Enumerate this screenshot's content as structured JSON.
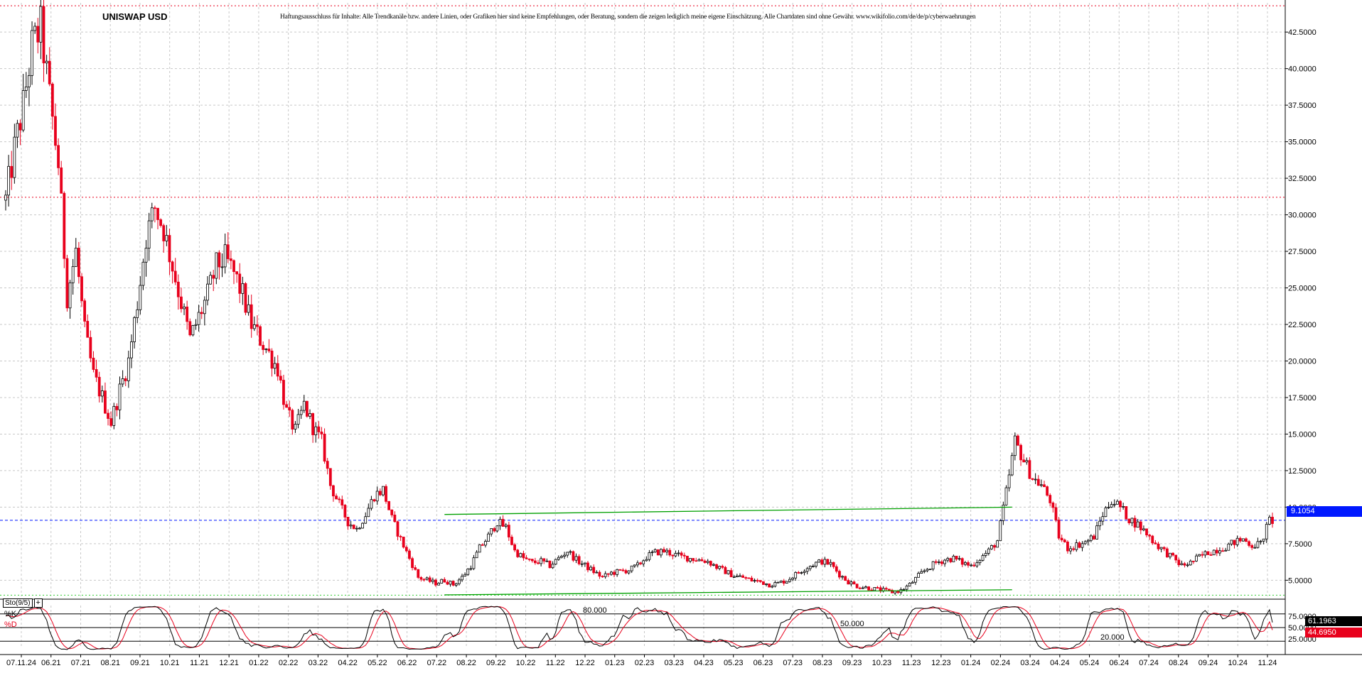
{
  "title": "UNISWAP USD",
  "disclaimer": "Haftungsausschluss für Inhalte: Alle Trendkanäle bzw. andere Linien, oder Grafiken hier sind keine Empfehlungen, oder Beratung, sondern die zeigen lediglich meine eigene Einschätzung. Alle Chartdaten sind ohne Gewähr.  www.wikifolio.com/de/de/p/cyberwaehrungen",
  "colors": {
    "up_candle": "#000000",
    "down_candle": "#e8001c",
    "trend_line": "#00a000",
    "current_price_line": "#0018ff",
    "stoch_k": "#000000",
    "stoch_d": "#e8001c",
    "grid": "#c8c8c8"
  },
  "indicator": {
    "name": "Sto(9/5)",
    "plus_icon": "+",
    "k_label": "%K",
    "d_label": "%D",
    "k_value": "61.1963",
    "d_value": "44.6950",
    "level_80": "80.000",
    "level_50": "50.000",
    "level_20": "20.000",
    "axis_ticks": [
      "75.0000",
      "50.0000",
      "25.0000"
    ]
  },
  "current_price": "9.1054",
  "chart_data": {
    "type": "candlestick",
    "title": "UNISWAP USD",
    "ylim": [
      3.9,
      44.5
    ],
    "y_ticks": [
      "5.0000",
      "7.5000",
      "10.0000",
      "12.5000",
      "15.0000",
      "17.5000",
      "20.0000",
      "22.5000",
      "25.0000",
      "27.5000",
      "30.0000",
      "32.5000",
      "35.0000",
      "37.5000",
      "40.0000",
      "42.5000"
    ],
    "x_ticks": [
      "07.11.24",
      "06.21",
      "07.21",
      "08.21",
      "09.21",
      "10.21",
      "11.21",
      "12.21",
      "01.22",
      "02.22",
      "03.22",
      "04.22",
      "05.22",
      "06.22",
      "07.22",
      "08.22",
      "09.22",
      "10.22",
      "11.22",
      "12.22",
      "01.23",
      "02.23",
      "03.23",
      "04.23",
      "05.23",
      "06.23",
      "07.23",
      "08.23",
      "09.23",
      "10.23",
      "11.23",
      "12.23",
      "01.24",
      "02.24",
      "03.24",
      "04.24",
      "05.24",
      "06.24",
      "07.24",
      "08.24",
      "09.24",
      "10.24",
      "11.24"
    ],
    "price_path": [
      [
        0,
        31.0
      ],
      [
        3,
        34.5
      ],
      [
        6,
        37.5
      ],
      [
        9,
        41.5
      ],
      [
        12,
        42.8
      ],
      [
        15,
        38.0
      ],
      [
        18,
        33.5
      ],
      [
        21,
        24.5
      ],
      [
        24,
        27.5
      ],
      [
        27,
        22.0
      ],
      [
        30,
        19.0
      ],
      [
        33,
        17.5
      ],
      [
        36,
        15.8
      ],
      [
        39,
        18.0
      ],
      [
        42,
        20.0
      ],
      [
        45,
        24.0
      ],
      [
        48,
        28.5
      ],
      [
        51,
        30.5
      ],
      [
        54,
        29.0
      ],
      [
        57,
        26.5
      ],
      [
        60,
        24.0
      ],
      [
        63,
        21.5
      ],
      [
        66,
        23.0
      ],
      [
        69,
        24.5
      ],
      [
        72,
        26.5
      ],
      [
        75,
        27.0
      ],
      [
        78,
        26.0
      ],
      [
        81,
        24.5
      ],
      [
        84,
        22.5
      ],
      [
        87,
        21.5
      ],
      [
        90,
        20.5
      ],
      [
        93,
        19.5
      ],
      [
        96,
        16.5
      ],
      [
        99,
        15.2
      ],
      [
        102,
        17.0
      ],
      [
        105,
        15.5
      ],
      [
        108,
        14.5
      ],
      [
        111,
        11.5
      ],
      [
        114,
        10.2
      ],
      [
        117,
        9.0
      ],
      [
        120,
        8.5
      ],
      [
        123,
        9.5
      ],
      [
        126,
        10.8
      ],
      [
        129,
        11.2
      ],
      [
        132,
        9.2
      ],
      [
        135,
        7.8
      ],
      [
        138,
        6.5
      ],
      [
        141,
        5.2
      ],
      [
        144,
        5.0
      ],
      [
        147,
        4.8
      ],
      [
        150,
        5.0
      ],
      [
        153,
        4.7
      ],
      [
        156,
        5.2
      ],
      [
        159,
        6.0
      ],
      [
        162,
        7.2
      ],
      [
        165,
        8.0
      ],
      [
        168,
        9.0
      ],
      [
        171,
        8.6
      ],
      [
        174,
        7.0
      ],
      [
        177,
        6.5
      ],
      [
        180,
        6.2
      ],
      [
        183,
        6.3
      ],
      [
        186,
        6.0
      ],
      [
        189,
        6.5
      ],
      [
        192,
        7.0
      ],
      [
        195,
        6.4
      ],
      [
        198,
        6.0
      ],
      [
        201,
        5.6
      ],
      [
        204,
        5.2
      ],
      [
        207,
        5.5
      ],
      [
        210,
        5.6
      ],
      [
        213,
        5.7
      ],
      [
        216,
        6.0
      ],
      [
        219,
        6.6
      ],
      [
        222,
        6.9
      ],
      [
        225,
        7.0
      ],
      [
        228,
        6.8
      ],
      [
        231,
        6.6
      ],
      [
        234,
        6.5
      ],
      [
        237,
        6.4
      ],
      [
        240,
        6.3
      ],
      [
        243,
        5.9
      ],
      [
        246,
        5.6
      ],
      [
        249,
        5.3
      ],
      [
        252,
        5.2
      ],
      [
        255,
        5.0
      ],
      [
        258,
        4.9
      ],
      [
        261,
        4.7
      ],
      [
        264,
        4.8
      ],
      [
        267,
        5.0
      ],
      [
        270,
        5.4
      ],
      [
        273,
        5.8
      ],
      [
        276,
        6.1
      ],
      [
        279,
        6.3
      ],
      [
        282,
        6.1
      ],
      [
        285,
        5.4
      ],
      [
        288,
        4.9
      ],
      [
        291,
        4.6
      ],
      [
        294,
        4.5
      ],
      [
        297,
        4.4
      ],
      [
        300,
        4.3
      ],
      [
        303,
        4.2
      ],
      [
        306,
        4.3
      ],
      [
        309,
        4.7
      ],
      [
        312,
        5.3
      ],
      [
        315,
        5.8
      ],
      [
        318,
        6.2
      ],
      [
        321,
        6.4
      ],
      [
        324,
        6.5
      ],
      [
        327,
        6.2
      ],
      [
        330,
        6.0
      ],
      [
        333,
        6.5
      ],
      [
        336,
        7.0
      ],
      [
        339,
        7.7
      ],
      [
        342,
        11.0
      ],
      [
        345,
        14.5
      ],
      [
        348,
        13.2
      ],
      [
        351,
        12.0
      ],
      [
        354,
        11.5
      ],
      [
        357,
        10.5
      ],
      [
        360,
        8.0
      ],
      [
        363,
        7.2
      ],
      [
        366,
        7.4
      ],
      [
        369,
        7.6
      ],
      [
        372,
        8.0
      ],
      [
        375,
        9.5
      ],
      [
        378,
        10.5
      ],
      [
        381,
        10.0
      ],
      [
        384,
        9.2
      ],
      [
        387,
        8.8
      ],
      [
        390,
        8.2
      ],
      [
        393,
        7.5
      ],
      [
        396,
        7.0
      ],
      [
        399,
        6.5
      ],
      [
        402,
        6.0
      ],
      [
        405,
        6.2
      ],
      [
        408,
        6.6
      ],
      [
        411,
        6.9
      ],
      [
        414,
        7.1
      ],
      [
        417,
        7.3
      ],
      [
        420,
        7.6
      ],
      [
        423,
        7.8
      ],
      [
        426,
        7.4
      ],
      [
        429,
        7.5
      ],
      [
        432,
        9.1
      ]
    ],
    "trendlines": [
      {
        "from": [
          150,
          9.5
        ],
        "to": [
          344,
          10.0
        ]
      },
      {
        "from": [
          150,
          4.0
        ],
        "to": [
          344,
          4.35
        ]
      }
    ],
    "horizontal_levels": [
      {
        "value": 44.3,
        "style": "red-dotted"
      },
      {
        "value": 31.2,
        "style": "red-dotted"
      },
      {
        "value": 9.1054,
        "style": "blue-dashed"
      },
      {
        "value": 3.98,
        "style": "green-dotted"
      }
    ],
    "stochastic": {
      "k_last": 61.1963,
      "d_last": 44.695,
      "levels": [
        80,
        50,
        20
      ]
    }
  }
}
